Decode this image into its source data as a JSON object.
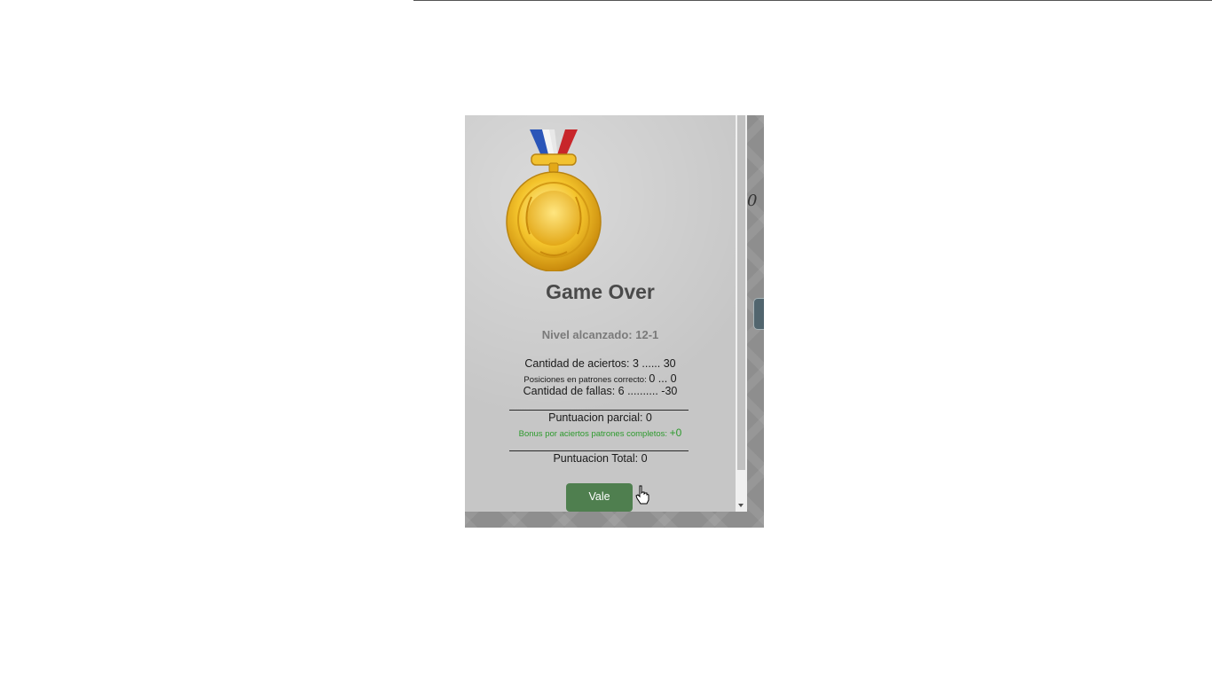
{
  "modal": {
    "title": "Game Over",
    "level_label": "Nivel alcanzado: 12-1",
    "aciertos": "Cantidad de aciertos: 3 ...... 30",
    "posiciones_label": "Posiciones en patrones correcto:",
    "posiciones_value": "0 ... 0",
    "fallas": "Cantidad de fallas: 6 .......... -30",
    "parcial": "Puntuacion parcial: 0",
    "bonus_label": "Bonus por aciertos patrones completos:",
    "bonus_value": "+0",
    "total": "Puntuacion Total: 0",
    "button_label": "Vale",
    "medal_icon": "gold-medal-icon"
  },
  "background": {
    "score_glyph": "0"
  },
  "colors": {
    "button": "#4f7f4f",
    "bonus_text": "#2e9a2e",
    "medal_gold": "#f2c230",
    "ribbon_blue": "#2a55b8",
    "ribbon_red": "#c8262a"
  }
}
